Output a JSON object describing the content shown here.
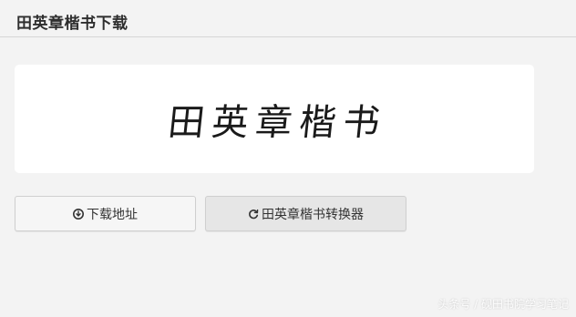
{
  "header": {
    "title": "田英章楷书下载"
  },
  "preview": {
    "sample_text": "田英章楷书"
  },
  "buttons": {
    "download_label": "下载地址",
    "download_icon": "arrow-circle-down-icon",
    "converter_label": "田英章楷书转换器",
    "converter_icon": "refresh-icon"
  },
  "watermark": {
    "text": "头条号 / 砚田书院学习笔记"
  },
  "colors": {
    "page_background": "#f3f3f3",
    "card_background": "#ffffff",
    "button_background": "#f6f6f6",
    "button_active_background": "#e6e6e6"
  }
}
